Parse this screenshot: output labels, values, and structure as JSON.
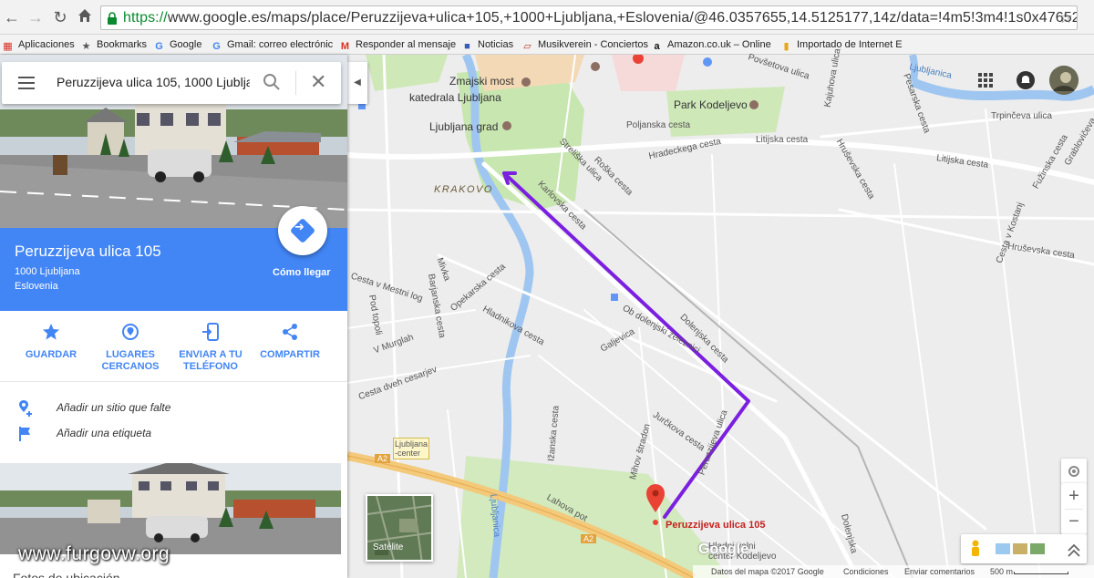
{
  "browser": {
    "url_proto": "https://",
    "url_rest": "www.google.es/maps/place/Peruzzijeva+ulica+105,+1000+Ljubljana,+Eslovenia/@46.0357655,14.5125177,14z/data=!4m5!3m4!1s0x47652dc",
    "nav_icons": [
      "back-icon",
      "forward-icon",
      "reload-icon",
      "home-icon"
    ]
  },
  "bookmarks": [
    {
      "label": "Aplicaciones",
      "icon": "apps-grid-icon"
    },
    {
      "label": "Bookmarks",
      "icon": "star-icon"
    },
    {
      "label": "Google",
      "icon": "google-g-icon"
    },
    {
      "label": "Gmail: correo electrónic",
      "icon": "google-g-icon"
    },
    {
      "label": "Responder al mensaje",
      "icon": "gmail-icon"
    },
    {
      "label": "Noticias",
      "icon": "news-icon"
    },
    {
      "label": "Musikverein - Conciertos",
      "icon": "page-icon"
    },
    {
      "label": "Amazon.co.uk – Online",
      "icon": "amazon-icon"
    },
    {
      "label": "Importado de Internet E",
      "icon": "folder-icon"
    }
  ],
  "search": {
    "query": "Peruzzijeva ulica 105, 1000 Ljubljana"
  },
  "place": {
    "name": "Peruzzijeva ulica 105",
    "city": "1000 Ljubljana",
    "country": "Eslovenia",
    "directions_label": "Cómo llegar"
  },
  "actions": [
    {
      "line1": "GUARDAR",
      "line2": ""
    },
    {
      "line1": "LUGARES",
      "line2": "CERCANOS"
    },
    {
      "line1": "ENVIAR A TU",
      "line2": "TELÉFONO"
    },
    {
      "line1": "COMPARTIR",
      "line2": ""
    }
  ],
  "rows": {
    "add_place": "Añadir un sitio que falte",
    "add_label": "Añadir una etiqueta"
  },
  "watermark": "www.furgovw.org",
  "cutoff_text": "Fotos de ubicación",
  "map": {
    "labels": {
      "zmajski_most": "Zmajski most",
      "katedrala": "katedrala Ljubljana",
      "grad": "Ljubljana grad",
      "krakovo": "KRAKOVO",
      "park": "Park Kodeljevo",
      "poljanska": "Poljanska cesta",
      "hradeckega": "Hradeckega cesta",
      "litijska1": "Litijska cesta",
      "litijska2": "Litijska cesta",
      "strelis": "Streliška ulica",
      "rozna": "Roška cesta",
      "karlovska": "Karlovska cesta",
      "povsetova": "Povšetova ulica",
      "kajuhova": "Kajuhova ulica",
      "pesarska": "Pesarska cesta",
      "trpinceva": "Trpinčeva ulica",
      "fuzinska": "Fužinska cesta",
      "grablovic": "Grablovičeva",
      "hruvska1": "Hruševska cesta",
      "hruvska2": "Hruševska cesta",
      "kostanj": "Cesta v Kostanj",
      "hrusev": "Hruševska",
      "ljubljanica": "Ljubljanica",
      "mestni": "Cesta v Mestni log",
      "opekarska": "Opekarska cesta",
      "mivka": "Mivka",
      "barjanska": "Barjanska cesta",
      "pod_topoli": "Pod topoli",
      "murglah": "V Murglah",
      "hladnikova": "Hladnikova cesta",
      "galjevica": "Galjevica",
      "ob_dolenj": "Ob dolenjski železnici",
      "dolenjska": "Dolenjska cesta",
      "cesarjev": "Cesta dveh cesarjev",
      "jurckova": "Jurčkova cesta",
      "ihanska": "Ižanska cesta",
      "mihov": "Mihov štradon",
      "lahova": "Lahova pot",
      "ljublj_center": "Ljubljana -center",
      "a2a": "A2",
      "a2b": "A2",
      "peruzz_road": "Peruzzijeva ulica",
      "dolenj2": "Dolenjska",
      "hladni": "Hladni valni center Kodeljevo",
      "ljubljanica2": "Ljubljanica"
    },
    "pin_label": "Peruzzijeva ulica 105",
    "satellite_label": "Satélite",
    "footer": {
      "data": "Datos del mapa ©2017 Google",
      "terms": "Condiciones",
      "feedback": "Enviar comentarios",
      "scale": "500 m"
    },
    "logo": "Google",
    "zoom_in": "+",
    "zoom_out": "−",
    "route_color": "#7b1fe0",
    "pin_color": "#ea4335"
  },
  "colors": {
    "blue": "#4285f4",
    "map_bg": "#ededed",
    "park": "#c8e6b0",
    "water": "#9fc6f0"
  }
}
